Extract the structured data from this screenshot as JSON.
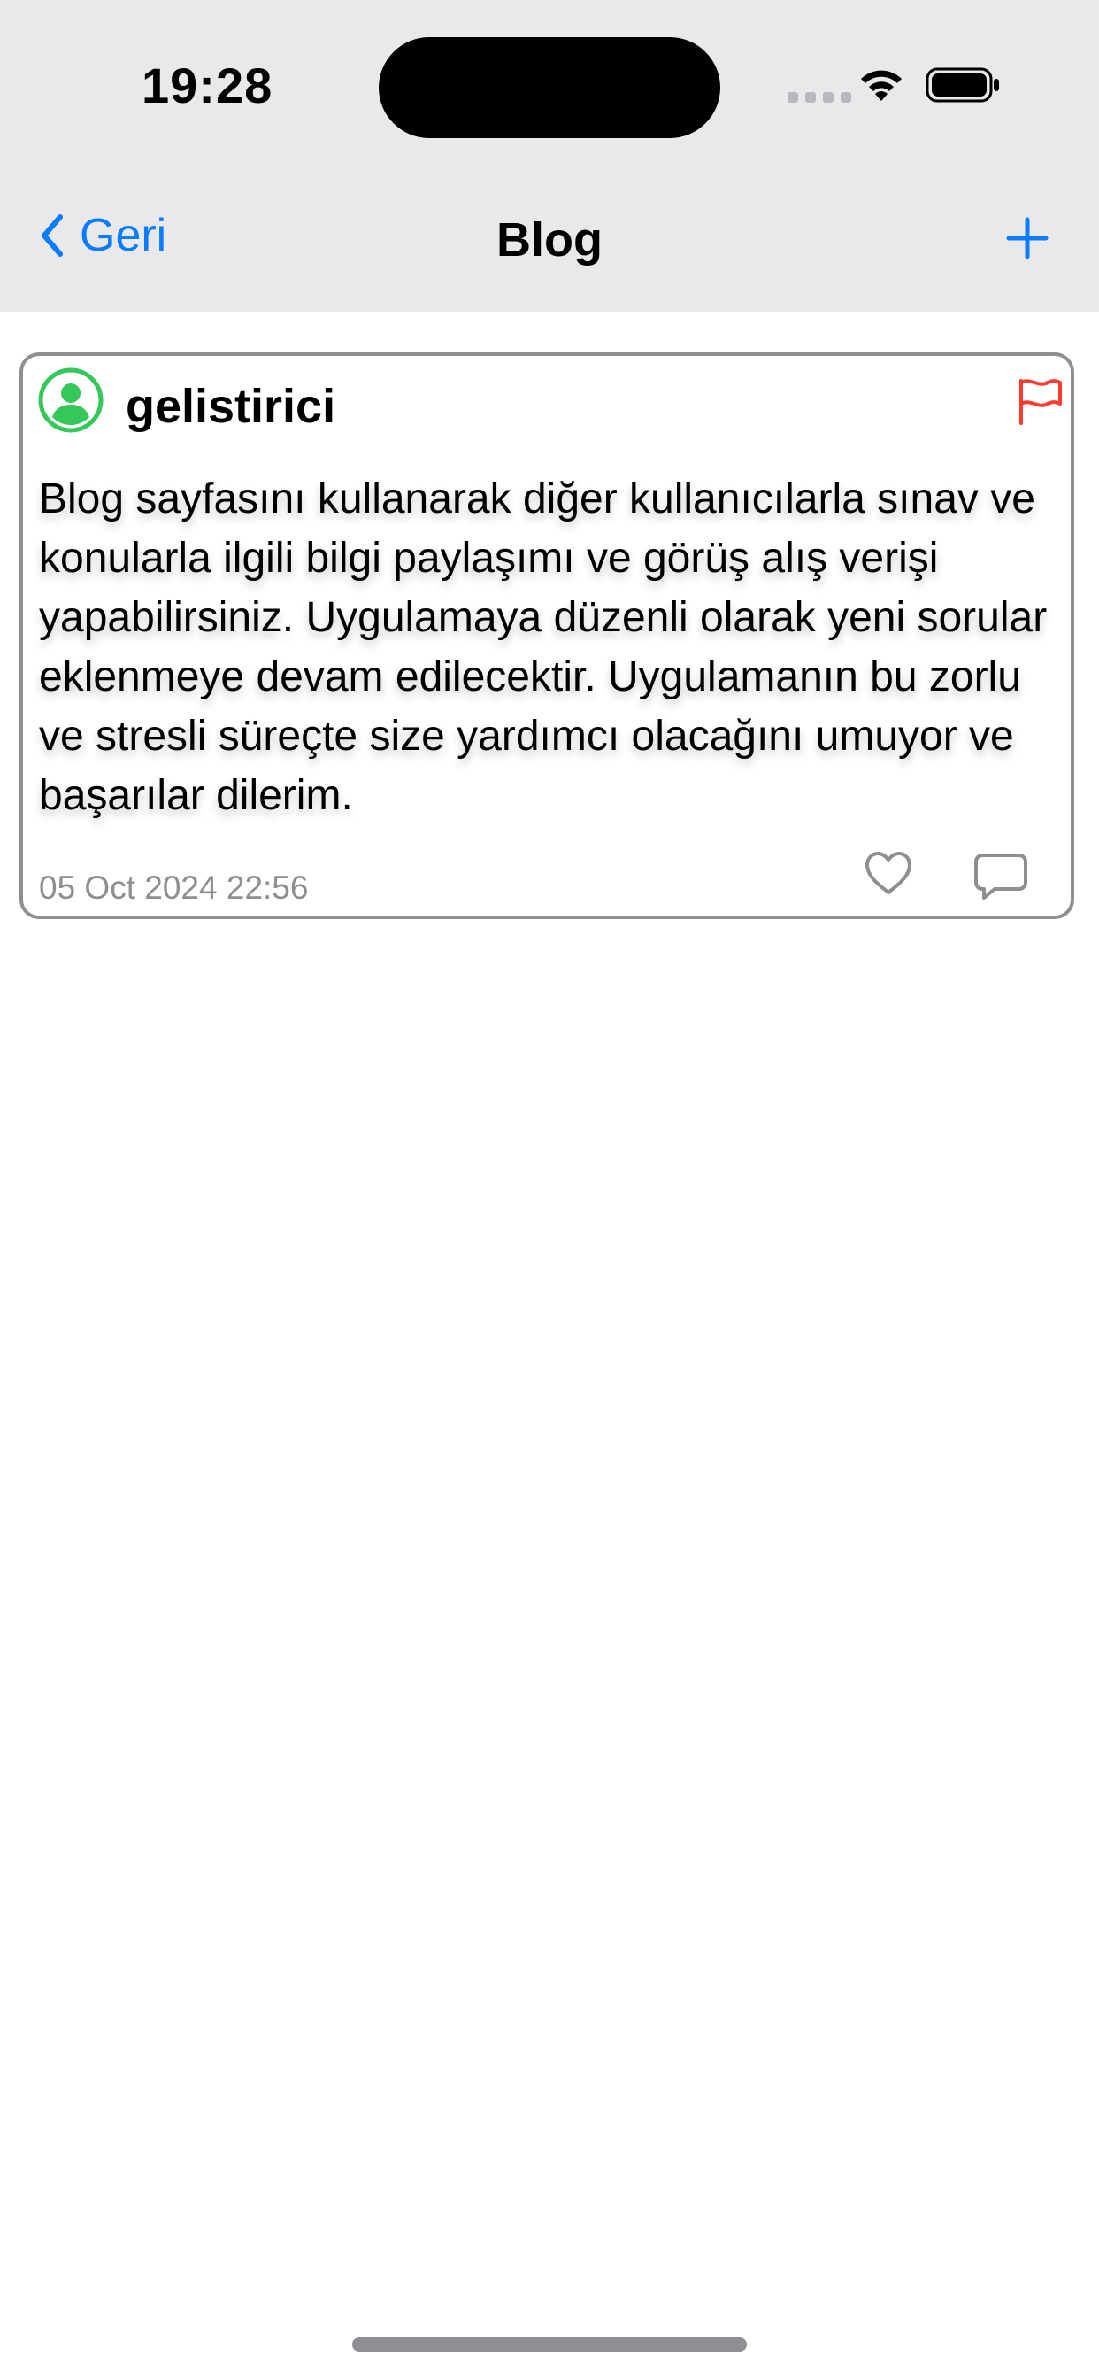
{
  "status_bar": {
    "time": "19:28",
    "icons": [
      "signal-icon",
      "wifi-icon",
      "battery-icon"
    ]
  },
  "nav": {
    "back_label": "Geri",
    "title": "Blog",
    "back_icon": "chevron-left-icon",
    "add_icon": "plus-icon"
  },
  "post": {
    "username": "gelistirici",
    "avatar_icon": "user-avatar-icon",
    "flag_icon": "flag-icon",
    "body": "Blog sayfasını kullanarak diğer kullanıcılarla sınav ve konularla ilgili bilgi paylaşımı ve görüş alış verişi yapabilirsiniz. Uygulamaya düzenli olarak yeni sorular eklenmeye devam edilecektir. Uygulamanın bu zorlu ve stresli süreçte size yardımcı olacağını umuyor ve başarılar dilerim.",
    "date": "05 Oct 2024 22:56",
    "like_icon": "heart-icon",
    "comment_icon": "comment-icon"
  },
  "colors": {
    "accent": "#0a7cff",
    "header_bg": "#e9e9eb",
    "avatar": "#34c759",
    "flag": "#ff3b30",
    "secondary_text": "#8e8e93"
  }
}
